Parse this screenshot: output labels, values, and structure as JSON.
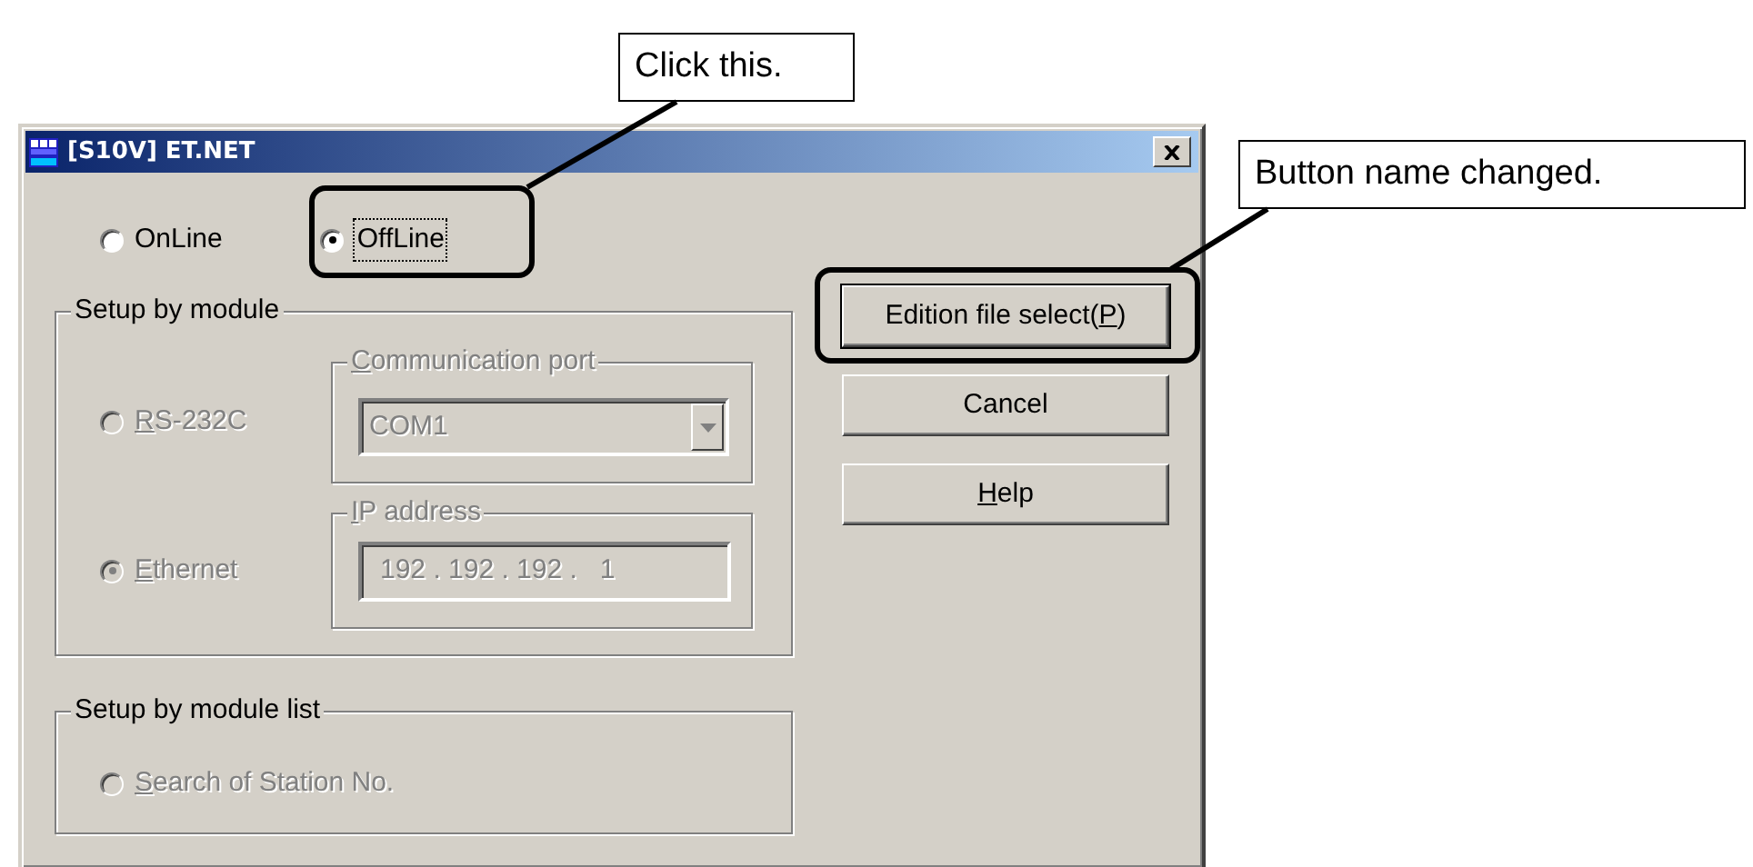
{
  "window": {
    "title": "[S10V] ET.NET"
  },
  "mode_options": [
    {
      "label": [
        {
          "text": "OnLine",
          "access_key": false
        }
      ],
      "selected": false,
      "focused": false
    },
    {
      "label": [
        {
          "text": "OffLine",
          "access_key": false
        }
      ],
      "selected": true,
      "focused": true
    }
  ],
  "setup_by_module": {
    "title": "Setup by module",
    "disabled": true,
    "connections": [
      {
        "label": [
          {
            "text": "R",
            "access_key": true
          },
          {
            "text": "S-232C",
            "access_key": false
          }
        ],
        "selected": false,
        "kind": "combo",
        "group_title": [
          {
            "text": "C",
            "access_key": true
          },
          {
            "text": "ommunication port",
            "access_key": false
          }
        ],
        "value": "COM1"
      },
      {
        "label": [
          {
            "text": "E",
            "access_key": true
          },
          {
            "text": "thernet",
            "access_key": false
          }
        ],
        "selected": true,
        "kind": "field",
        "group_title": [
          {
            "text": "I",
            "access_key": true
          },
          {
            "text": "P address",
            "access_key": false
          }
        ],
        "value": "192 . 192 . 192 .   1"
      }
    ]
  },
  "setup_by_module_list": {
    "title": "Setup by module list",
    "disabled": true,
    "options": [
      {
        "label": [
          {
            "text": "S",
            "access_key": true
          },
          {
            "text": "earch of Station No.",
            "access_key": false
          }
        ],
        "selected": false
      }
    ]
  },
  "buttons": [
    {
      "label": [
        {
          "text": "Edition file select(",
          "access_key": false
        },
        {
          "text": "P",
          "access_key": true
        },
        {
          "text": ")",
          "access_key": false
        }
      ],
      "default": true
    },
    {
      "label": [
        {
          "text": "Cancel",
          "access_key": false
        }
      ],
      "default": false
    },
    {
      "label": [
        {
          "text": "H",
          "access_key": true
        },
        {
          "text": "elp",
          "access_key": false
        }
      ],
      "default": false
    }
  ],
  "callouts": [
    {
      "text": "Click this."
    },
    {
      "text": "Button name changed."
    }
  ]
}
